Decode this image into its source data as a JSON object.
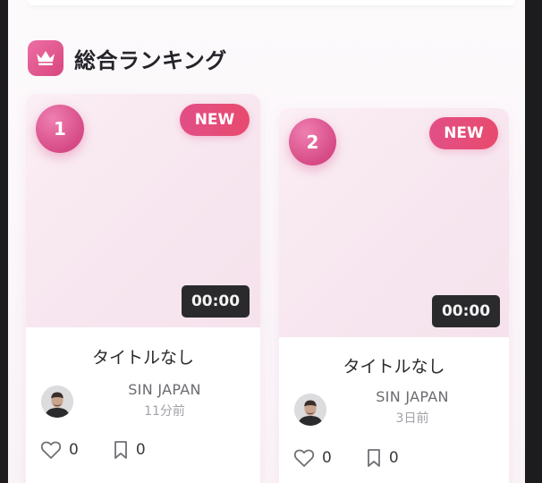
{
  "section": {
    "title": "総合ランキング",
    "icon": "crown-icon"
  },
  "colors": {
    "accent": "#d9457f",
    "badge": "#e24f86"
  },
  "videos": [
    {
      "rank": "1",
      "badge": "NEW",
      "duration": "00:00",
      "title": "タイトルなし",
      "author": "SIN JAPAN",
      "time": "11分前",
      "likes": "0",
      "bookmarks": "0"
    },
    {
      "rank": "2",
      "badge": "NEW",
      "duration": "00:00",
      "title": "タイトルなし",
      "author": "SIN JAPAN",
      "time": "3日前",
      "likes": "0",
      "bookmarks": "0"
    }
  ]
}
